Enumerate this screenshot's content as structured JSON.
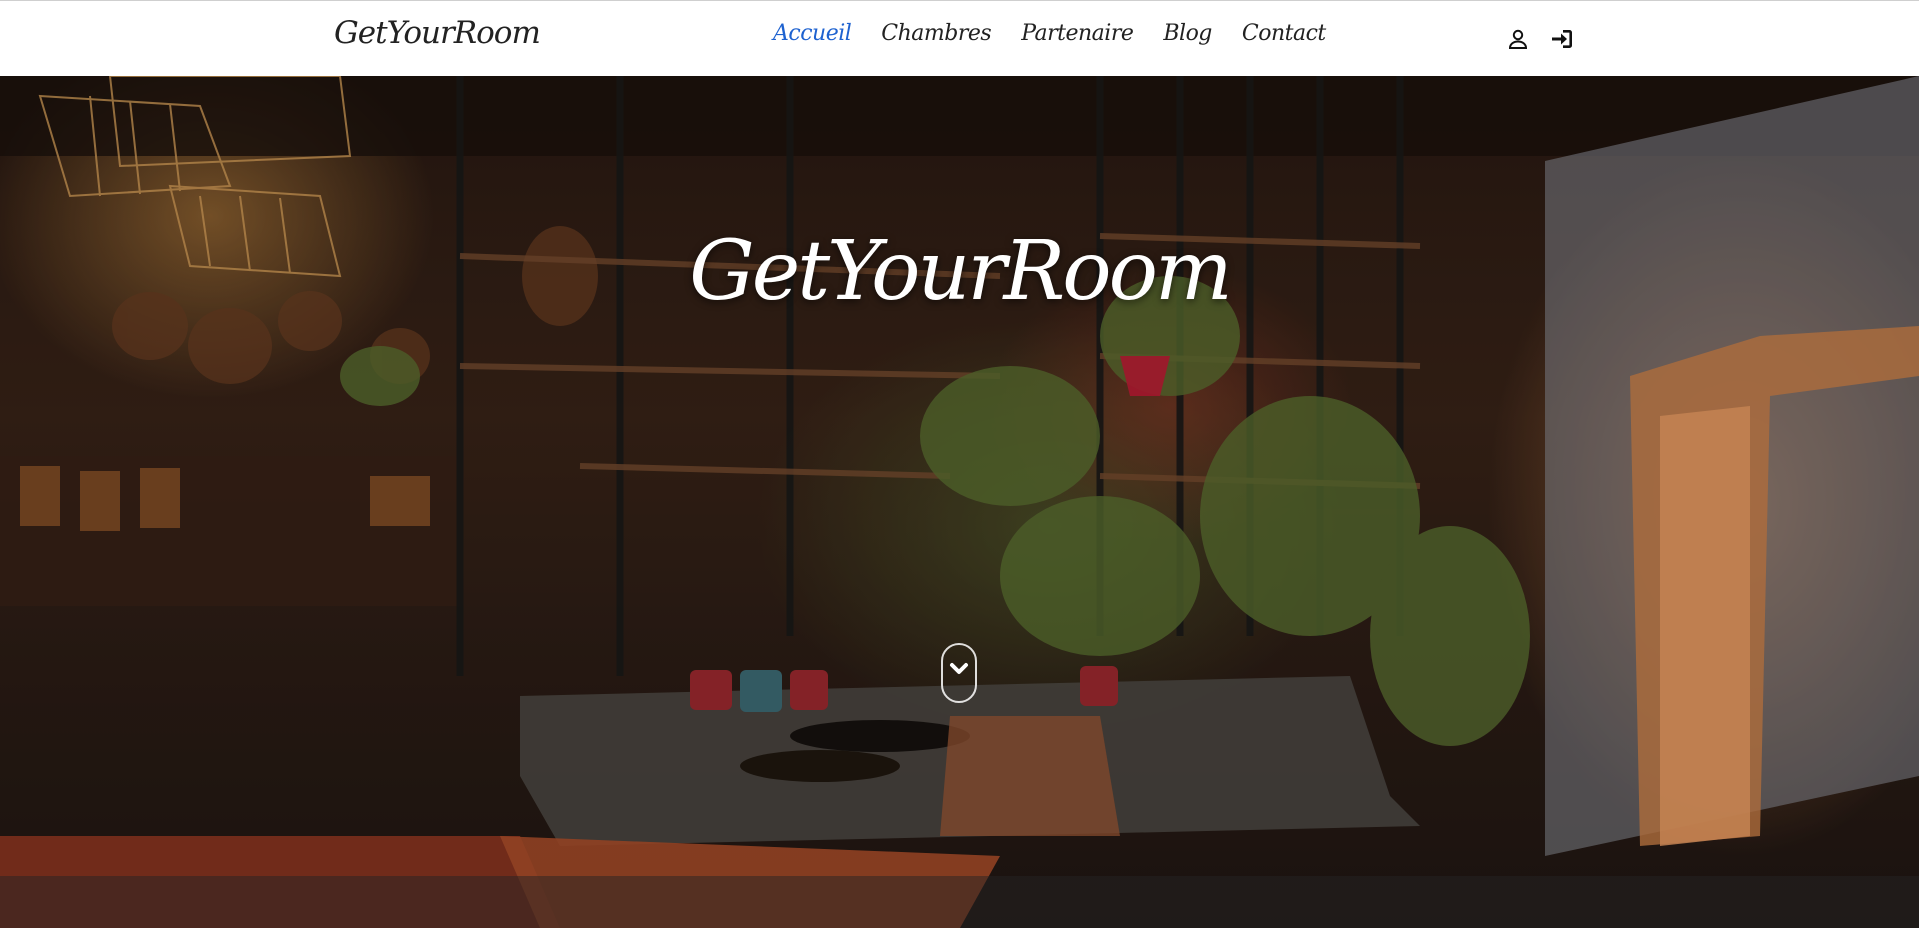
{
  "navbar": {
    "brand": "GetYourRoom",
    "links": [
      {
        "label": "Accueil",
        "active": true
      },
      {
        "label": "Chambres",
        "active": false
      },
      {
        "label": "Partenaire",
        "active": false
      },
      {
        "label": "Blog",
        "active": false
      },
      {
        "label": "Contact",
        "active": false
      }
    ],
    "icons": [
      "user-icon",
      "sign-in-icon"
    ],
    "active_color": "#1e62d0"
  },
  "hero": {
    "title": "GetYourRoom",
    "scroll_icon": "chevron-down-icon"
  }
}
